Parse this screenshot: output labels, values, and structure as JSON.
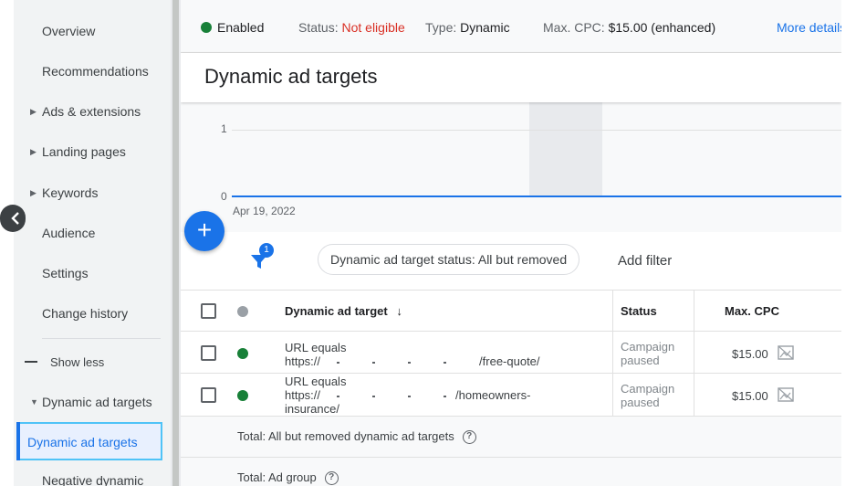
{
  "sidebar": {
    "items": [
      {
        "label": "Overview",
        "caret": ""
      },
      {
        "label": "Recommendations",
        "caret": ""
      },
      {
        "label": "Ads & extensions",
        "caret": "▶"
      },
      {
        "label": "Landing pages",
        "caret": "▶"
      },
      {
        "label": "Keywords",
        "caret": "▶"
      },
      {
        "label": "Audience",
        "caret": ""
      },
      {
        "label": "Settings",
        "caret": ""
      },
      {
        "label": "Change history",
        "caret": ""
      }
    ],
    "show_less": "Show less",
    "group_label": "Dynamic ad targets",
    "group_caret": "▼",
    "active_item": "Dynamic ad targets",
    "cut_item": "Negative dynamic"
  },
  "topbar": {
    "enabled": "Enabled",
    "status_label": "Status:",
    "status_value": "Not eligible",
    "type_label": "Type:",
    "type_value": "Dynamic",
    "maxcpc_label": "Max. CPC:",
    "maxcpc_value": "$15.00 (enhanced)",
    "more_details": "More details"
  },
  "page_title": "Dynamic ad targets",
  "chart": {
    "y_ticks": [
      "1",
      "0"
    ],
    "x_tick": "Apr 19, 2022"
  },
  "fab_icon": "+",
  "filters": {
    "badge": "1",
    "chip": "Dynamic ad target status: All but removed",
    "add_filter": "Add filter"
  },
  "table": {
    "headers": {
      "target": "Dynamic ad target",
      "sort_arrow": "↓",
      "status": "Status",
      "max_cpc": "Max. CPC"
    },
    "rows": [
      {
        "line1": "URL equals",
        "line2_prefix": "https://",
        "line2_suffix": "/free-quote/",
        "line3": "",
        "status_1": "Campaign",
        "status_2": "paused",
        "max_cpc": "$15.00"
      },
      {
        "line1": "URL equals",
        "line2_prefix": "https://",
        "line2_suffix": "/homeowners-",
        "line3": "insurance/",
        "status_1": "Campaign",
        "status_2": "paused",
        "max_cpc": "$15.00"
      }
    ],
    "total_1": "Total: All but removed dynamic ad targets",
    "total_2": "Total: Ad group",
    "help_glyph": "?"
  },
  "colors": {
    "accent": "#1a73e8",
    "enabled": "#188038",
    "error": "#d93025"
  }
}
